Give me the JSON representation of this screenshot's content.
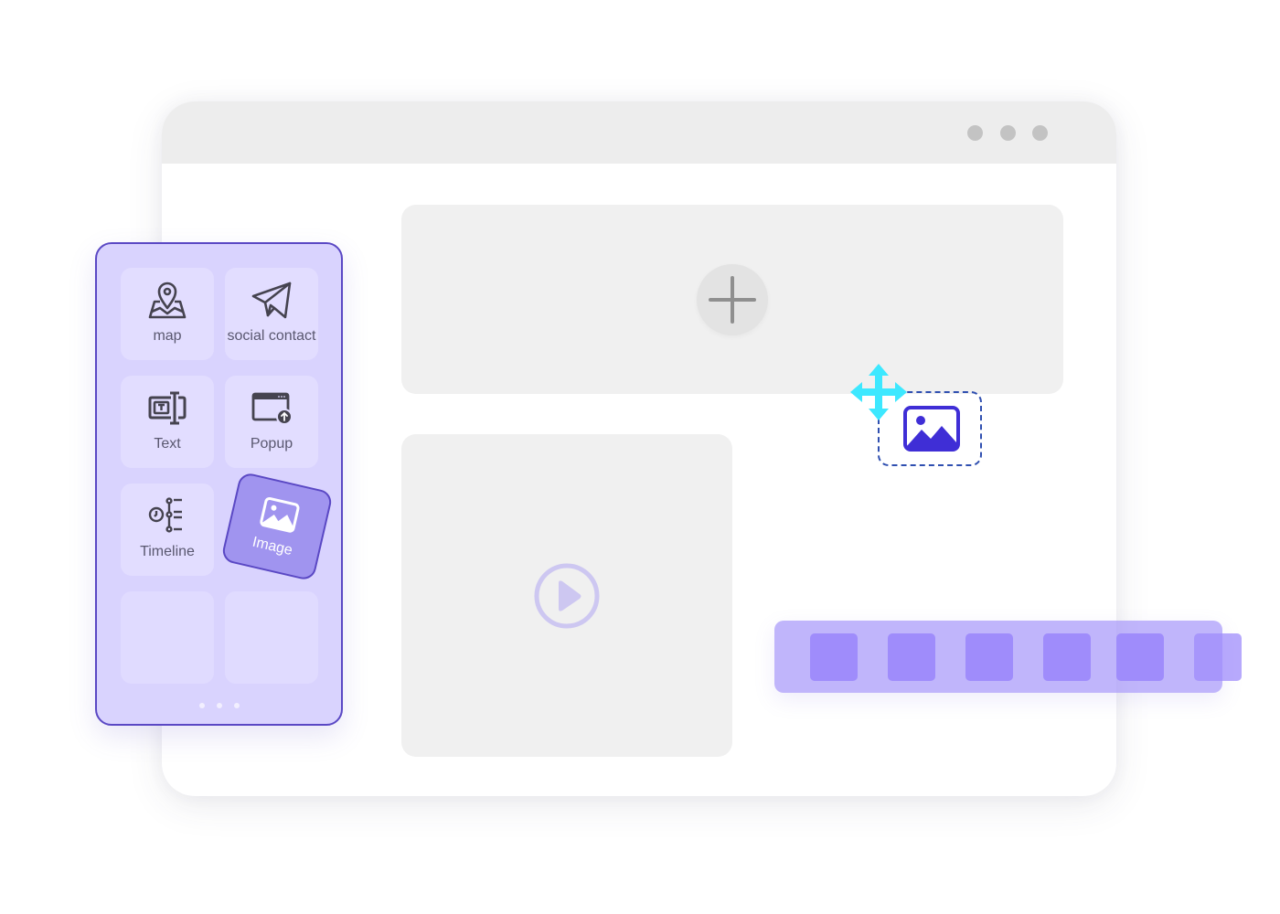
{
  "window": {
    "titlebar_dots": [
      "dot-1",
      "dot-2",
      "dot-3"
    ],
    "panels": {
      "top": {
        "action_icon": "plus-icon"
      },
      "video": {
        "action_icon": "play-icon"
      }
    }
  },
  "drag": {
    "move_icon": "move-arrows-icon",
    "dropped_icon": "image-icon"
  },
  "strip": {
    "item_count": 6
  },
  "palette": {
    "tiles": [
      {
        "label": "map",
        "icon": "map-pin-icon"
      },
      {
        "label": "social contact",
        "icon": "paper-plane-icon"
      },
      {
        "label": "Text",
        "icon": "text-box-icon"
      },
      {
        "label": "Popup",
        "icon": "popup-window-icon"
      },
      {
        "label": "Timeline",
        "icon": "timeline-icon"
      },
      {
        "label": "Image",
        "icon": "image-icon",
        "state": "dragging"
      }
    ],
    "pager": {
      "pages": 3,
      "current": 1
    }
  },
  "colors": {
    "accent": "#5a48c4",
    "palette_bg": "#d9d3fe",
    "drag_tile": "#a094ef",
    "move_cursor": "#3de8ff",
    "drop_icon": "#3f2ed6",
    "strip_bg": "#bfb5fc",
    "strip_item": "#9f8cfb"
  }
}
